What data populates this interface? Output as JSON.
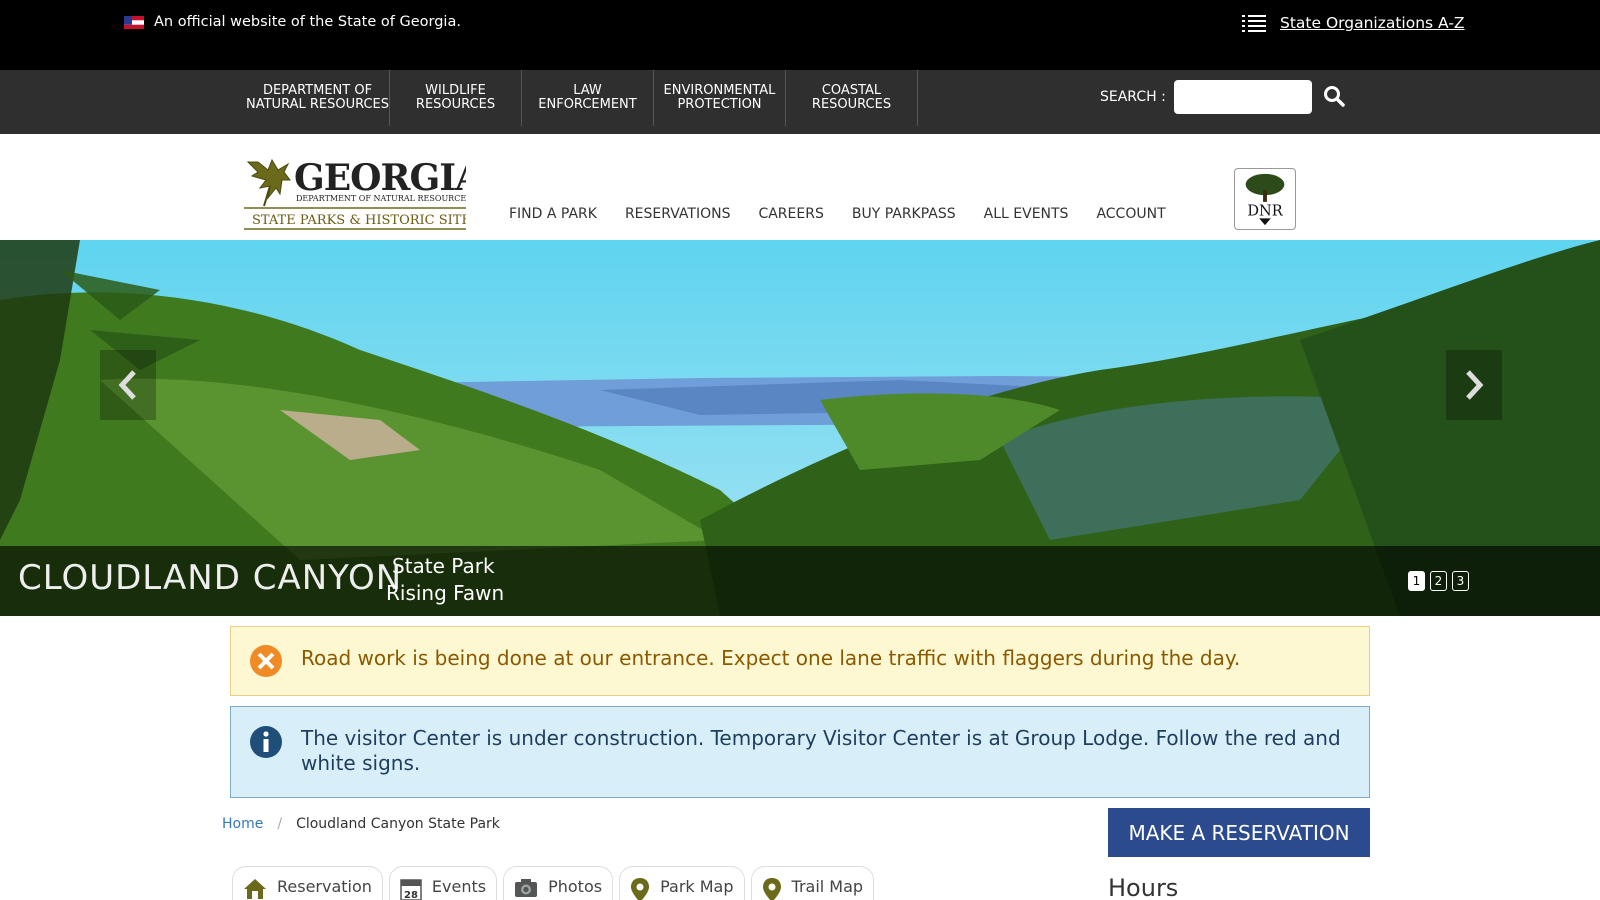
{
  "topbar": {
    "official_text": "An official website of the State of Georgia.",
    "orgs_link": "State Organizations A-Z"
  },
  "agency_nav": {
    "items": [
      "DEPARTMENT OF\nNATURAL RESOURCES",
      "WILDLIFE\nRESOURCES",
      "LAW\nENFORCEMENT",
      "ENVIRONMENTAL\nPROTECTION",
      "COASTAL\nRESOURCES"
    ],
    "search_label": "SEARCH :",
    "search_value": ""
  },
  "logo": {
    "title": "GEORGIA",
    "subtitle": "DEPARTMENT OF NATURAL RESOURCES",
    "tagline": "STATE PARKS & HISTORIC SITES"
  },
  "main_nav": [
    "FIND A PARK",
    "RESERVATIONS",
    "CAREERS",
    "BUY PARKPASS",
    "ALL EVENTS",
    "ACCOUNT"
  ],
  "dnr_badge": "DNR",
  "hero": {
    "park_name": "CLOUDLAND CANYON",
    "park_type": "State Park",
    "park_town": "Rising Fawn",
    "slides": [
      "1",
      "2",
      "3"
    ],
    "active_slide": 1
  },
  "alerts": {
    "warning": "Road work is being done at our entrance. Expect one lane traffic with flaggers during the day.",
    "info": "The visitor Center is under construction. Temporary Visitor Center is at Group Lodge. Follow the red and white signs."
  },
  "breadcrumb": {
    "home": "Home",
    "separator": "/",
    "current": "Cloudland Canyon State Park"
  },
  "reservation_button": "MAKE A RESERVATION",
  "hours_heading": "Hours",
  "tabs": [
    {
      "label": "Reservation",
      "icon": "home-icon"
    },
    {
      "label": "Events",
      "icon": "calendar-icon",
      "icon_text": "28"
    },
    {
      "label": "Photos",
      "icon": "camera-icon"
    },
    {
      "label": "Park Map",
      "icon": "map-pin-icon"
    },
    {
      "label": "Trail Map",
      "icon": "map-pin-icon"
    }
  ],
  "colors": {
    "topbar": "#000000",
    "agency_bar": "#2f2f2f",
    "reserve_button": "#2c4a8e",
    "warning_bg": "#fdf7d2",
    "info_bg": "#d8eef8",
    "link": "#337ab7"
  }
}
